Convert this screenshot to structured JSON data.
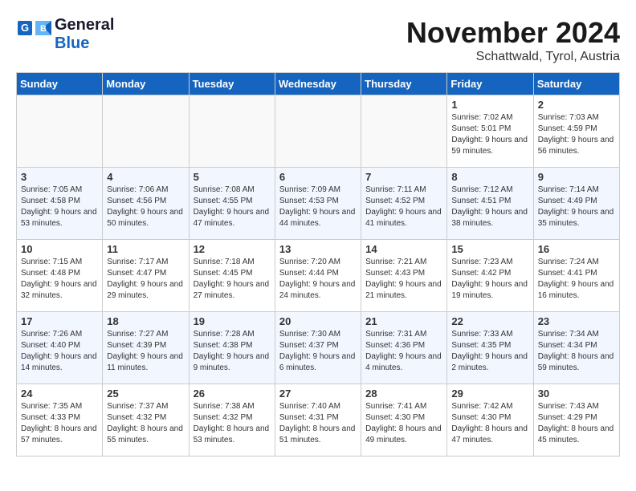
{
  "header": {
    "logo_line1": "General",
    "logo_line2": "Blue",
    "month": "November 2024",
    "location": "Schattwald, Tyrol, Austria"
  },
  "weekdays": [
    "Sunday",
    "Monday",
    "Tuesday",
    "Wednesday",
    "Thursday",
    "Friday",
    "Saturday"
  ],
  "weeks": [
    [
      {
        "day": "",
        "info": ""
      },
      {
        "day": "",
        "info": ""
      },
      {
        "day": "",
        "info": ""
      },
      {
        "day": "",
        "info": ""
      },
      {
        "day": "",
        "info": ""
      },
      {
        "day": "1",
        "info": "Sunrise: 7:02 AM\nSunset: 5:01 PM\nDaylight: 9 hours and 59 minutes."
      },
      {
        "day": "2",
        "info": "Sunrise: 7:03 AM\nSunset: 4:59 PM\nDaylight: 9 hours and 56 minutes."
      }
    ],
    [
      {
        "day": "3",
        "info": "Sunrise: 7:05 AM\nSunset: 4:58 PM\nDaylight: 9 hours and 53 minutes."
      },
      {
        "day": "4",
        "info": "Sunrise: 7:06 AM\nSunset: 4:56 PM\nDaylight: 9 hours and 50 minutes."
      },
      {
        "day": "5",
        "info": "Sunrise: 7:08 AM\nSunset: 4:55 PM\nDaylight: 9 hours and 47 minutes."
      },
      {
        "day": "6",
        "info": "Sunrise: 7:09 AM\nSunset: 4:53 PM\nDaylight: 9 hours and 44 minutes."
      },
      {
        "day": "7",
        "info": "Sunrise: 7:11 AM\nSunset: 4:52 PM\nDaylight: 9 hours and 41 minutes."
      },
      {
        "day": "8",
        "info": "Sunrise: 7:12 AM\nSunset: 4:51 PM\nDaylight: 9 hours and 38 minutes."
      },
      {
        "day": "9",
        "info": "Sunrise: 7:14 AM\nSunset: 4:49 PM\nDaylight: 9 hours and 35 minutes."
      }
    ],
    [
      {
        "day": "10",
        "info": "Sunrise: 7:15 AM\nSunset: 4:48 PM\nDaylight: 9 hours and 32 minutes."
      },
      {
        "day": "11",
        "info": "Sunrise: 7:17 AM\nSunset: 4:47 PM\nDaylight: 9 hours and 29 minutes."
      },
      {
        "day": "12",
        "info": "Sunrise: 7:18 AM\nSunset: 4:45 PM\nDaylight: 9 hours and 27 minutes."
      },
      {
        "day": "13",
        "info": "Sunrise: 7:20 AM\nSunset: 4:44 PM\nDaylight: 9 hours and 24 minutes."
      },
      {
        "day": "14",
        "info": "Sunrise: 7:21 AM\nSunset: 4:43 PM\nDaylight: 9 hours and 21 minutes."
      },
      {
        "day": "15",
        "info": "Sunrise: 7:23 AM\nSunset: 4:42 PM\nDaylight: 9 hours and 19 minutes."
      },
      {
        "day": "16",
        "info": "Sunrise: 7:24 AM\nSunset: 4:41 PM\nDaylight: 9 hours and 16 minutes."
      }
    ],
    [
      {
        "day": "17",
        "info": "Sunrise: 7:26 AM\nSunset: 4:40 PM\nDaylight: 9 hours and 14 minutes."
      },
      {
        "day": "18",
        "info": "Sunrise: 7:27 AM\nSunset: 4:39 PM\nDaylight: 9 hours and 11 minutes."
      },
      {
        "day": "19",
        "info": "Sunrise: 7:28 AM\nSunset: 4:38 PM\nDaylight: 9 hours and 9 minutes."
      },
      {
        "day": "20",
        "info": "Sunrise: 7:30 AM\nSunset: 4:37 PM\nDaylight: 9 hours and 6 minutes."
      },
      {
        "day": "21",
        "info": "Sunrise: 7:31 AM\nSunset: 4:36 PM\nDaylight: 9 hours and 4 minutes."
      },
      {
        "day": "22",
        "info": "Sunrise: 7:33 AM\nSunset: 4:35 PM\nDaylight: 9 hours and 2 minutes."
      },
      {
        "day": "23",
        "info": "Sunrise: 7:34 AM\nSunset: 4:34 PM\nDaylight: 8 hours and 59 minutes."
      }
    ],
    [
      {
        "day": "24",
        "info": "Sunrise: 7:35 AM\nSunset: 4:33 PM\nDaylight: 8 hours and 57 minutes."
      },
      {
        "day": "25",
        "info": "Sunrise: 7:37 AM\nSunset: 4:32 PM\nDaylight: 8 hours and 55 minutes."
      },
      {
        "day": "26",
        "info": "Sunrise: 7:38 AM\nSunset: 4:32 PM\nDaylight: 8 hours and 53 minutes."
      },
      {
        "day": "27",
        "info": "Sunrise: 7:40 AM\nSunset: 4:31 PM\nDaylight: 8 hours and 51 minutes."
      },
      {
        "day": "28",
        "info": "Sunrise: 7:41 AM\nSunset: 4:30 PM\nDaylight: 8 hours and 49 minutes."
      },
      {
        "day": "29",
        "info": "Sunrise: 7:42 AM\nSunset: 4:30 PM\nDaylight: 8 hours and 47 minutes."
      },
      {
        "day": "30",
        "info": "Sunrise: 7:43 AM\nSunset: 4:29 PM\nDaylight: 8 hours and 45 minutes."
      }
    ]
  ]
}
